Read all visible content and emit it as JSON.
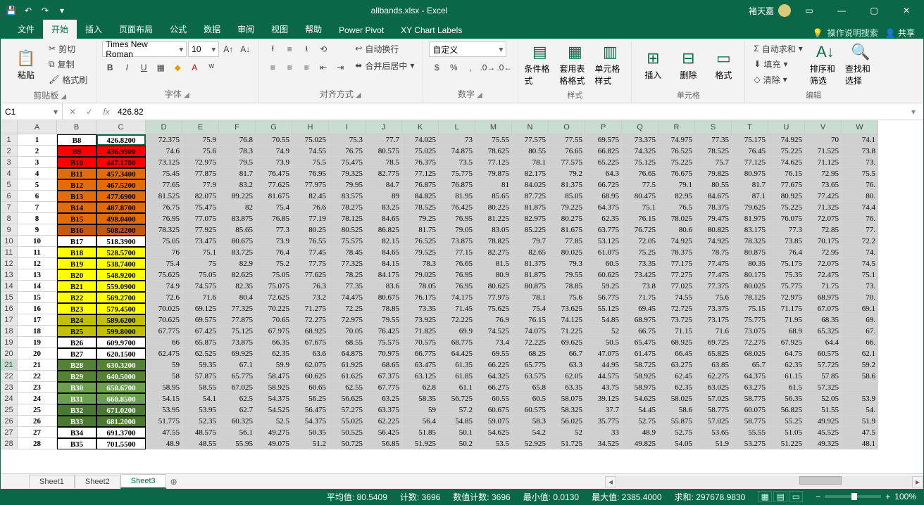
{
  "title": "allbands.xlsx - Excel",
  "user": "褚天嘉",
  "tabs": [
    "文件",
    "开始",
    "插入",
    "页面布局",
    "公式",
    "数据",
    "审阅",
    "视图",
    "帮助",
    "Power Pivot",
    "XY Chart Labels"
  ],
  "tell_me": "操作说明搜索",
  "share": "共享",
  "ribbon": {
    "clipboard": {
      "paste": "粘贴",
      "cut": "剪切",
      "copy": "复制",
      "painter": "格式刷",
      "label": "剪贴板"
    },
    "font": {
      "name": "Times New Roman",
      "size": "10",
      "label": "字体"
    },
    "align": {
      "wrap": "自动换行",
      "merge": "合并后居中",
      "label": "对齐方式"
    },
    "number": {
      "format": "自定义",
      "label": "数字"
    },
    "styles": {
      "cond": "条件格式",
      "table": "套用表格格式",
      "cell": "单元格样式",
      "label": "样式"
    },
    "cells": {
      "insert": "插入",
      "delete": "删除",
      "format": "格式",
      "label": "单元格"
    },
    "editing": {
      "sum": "自动求和",
      "fill": "填充",
      "clear": "清除",
      "sort": "排序和筛选",
      "find": "查找和选择",
      "label": "编辑"
    }
  },
  "namebox": "C1",
  "formula": "426.82",
  "cols": [
    "",
    "A",
    "B",
    "C",
    "D",
    "E",
    "F",
    "G",
    "H",
    "I",
    "J",
    "K",
    "L",
    "M",
    "N",
    "O",
    "P",
    "Q",
    "R",
    "S",
    "T",
    "U",
    "V",
    "W"
  ],
  "bfill": {
    "B8": "#ffffff",
    "B9": "#ff0000",
    "B10": "#ff0000",
    "B11": "#e26b0a",
    "B12": "#e26b0a",
    "B13": "#e26b0a",
    "B14": "#e26b0a",
    "B15": "#e26b0a",
    "B16": "#c65911",
    "B17": "#ffffff",
    "B18": "#ffff00",
    "B19": "#ffff00",
    "B20": "#ffff00",
    "B21": "#ffff00",
    "B22": "#ffff00",
    "B23": "#ffff00",
    "B24": "#c1c000",
    "B25": "#c1c000",
    "B26": "#ffffff",
    "B27": "#ffffff",
    "B28": "#548235",
    "B29": "#548235",
    "B30": "#6aa050",
    "B31": "#6aa050",
    "B32": "#4a7a32",
    "B33": "#4a7a32",
    "B34": "#ffffff",
    "B35": "#ffffff"
  },
  "btext": {
    "B8": "#000",
    "B9": "#000",
    "B10": "#000",
    "B11": "#000",
    "B12": "#000",
    "B13": "#000",
    "B14": "#000",
    "B15": "#000",
    "B16": "#000",
    "B17": "#000",
    "B18": "#000",
    "B19": "#000",
    "B20": "#000",
    "B21": "#000",
    "B22": "#000",
    "B23": "#000",
    "B24": "#000",
    "B25": "#000",
    "B26": "#000",
    "B27": "#000",
    "B28": "#fff",
    "B29": "#fff",
    "B30": "#fff",
    "B31": "#fff",
    "B32": "#fff",
    "B33": "#fff",
    "B34": "#000",
    "B35": "#000"
  },
  "rows": [
    {
      "n": 1,
      "a": "1",
      "b": "B8",
      "c": "426.8200",
      "d": [
        "72.375",
        "75.9",
        "76.8",
        "70.55",
        "75.025",
        "75.3",
        "77.7",
        "74.025",
        "73",
        "75.55",
        "77.575",
        "77.55",
        "69.575",
        "73.375",
        "74.975",
        "77.35",
        "75.175",
        "74.925",
        "70",
        "74.1"
      ]
    },
    {
      "n": 2,
      "a": "2",
      "b": "B9",
      "c": "436.9900",
      "d": [
        "74.6",
        "75.6",
        "78.3",
        "74.9",
        "74.55",
        "76.75",
        "80.575",
        "75.025",
        "74.875",
        "78.625",
        "80.55",
        "76.65",
        "66.825",
        "74.325",
        "76.525",
        "78.525",
        "76.45",
        "75.225",
        "71.525",
        "73.8"
      ]
    },
    {
      "n": 3,
      "a": "3",
      "b": "B10",
      "c": "447.1700",
      "d": [
        "73.125",
        "72.975",
        "79.5",
        "73.9",
        "75.5",
        "75.475",
        "78.5",
        "76.375",
        "73.5",
        "77.125",
        "78.1",
        "77.575",
        "65.225",
        "75.125",
        "75.225",
        "75.7",
        "77.125",
        "74.625",
        "71.125",
        "73."
      ]
    },
    {
      "n": 4,
      "a": "4",
      "b": "B11",
      "c": "457.3400",
      "d": [
        "75.45",
        "77.875",
        "81.7",
        "76.475",
        "76.95",
        "79.325",
        "82.775",
        "77.125",
        "75.775",
        "79.875",
        "82.175",
        "79.2",
        "64.3",
        "76.65",
        "76.675",
        "79.825",
        "80.975",
        "76.15",
        "72.95",
        "75.5"
      ]
    },
    {
      "n": 5,
      "a": "5",
      "b": "B12",
      "c": "467.5200",
      "d": [
        "77.65",
        "77.9",
        "83.2",
        "77.625",
        "77.975",
        "79.95",
        "84.7",
        "76.875",
        "76.875",
        "81",
        "84.025",
        "81.375",
        "66.725",
        "77.5",
        "79.1",
        "80.55",
        "81.7",
        "77.675",
        "73.65",
        "76."
      ]
    },
    {
      "n": 6,
      "a": "6",
      "b": "B13",
      "c": "477.6900",
      "d": [
        "81.525",
        "82.075",
        "89.225",
        "81.675",
        "82.45",
        "83.575",
        "89",
        "84.825",
        "81.95",
        "85.65",
        "87.725",
        "85.05",
        "68.95",
        "80.475",
        "82.95",
        "84.675",
        "87.1",
        "80.925",
        "77.425",
        "80."
      ]
    },
    {
      "n": 7,
      "a": "7",
      "b": "B14",
      "c": "487.8700",
      "d": [
        "76.75",
        "75.475",
        "82",
        "75.4",
        "76.6",
        "78.275",
        "83.25",
        "78.525",
        "76.425",
        "80.225",
        "81.875",
        "79.225",
        "64.375",
        "75.1",
        "76.5",
        "78.375",
        "79.625",
        "75.225",
        "71.325",
        "74.4"
      ]
    },
    {
      "n": 8,
      "a": "8",
      "b": "B15",
      "c": "498.0400",
      "d": [
        "76.95",
        "77.075",
        "83.875",
        "76.85",
        "77.19",
        "78.125",
        "84.65",
        "79.25",
        "76.95",
        "81.225",
        "82.975",
        "80.275",
        "62.35",
        "76.15",
        "78.025",
        "79.475",
        "81.975",
        "76.075",
        "72.075",
        "76."
      ]
    },
    {
      "n": 9,
      "a": "9",
      "b": "B16",
      "c": "508.2200",
      "d": [
        "78.325",
        "77.925",
        "85.65",
        "77.3",
        "80.25",
        "80.525",
        "86.825",
        "81.75",
        "79.05",
        "83.05",
        "85.225",
        "81.675",
        "63.775",
        "76.725",
        "80.6",
        "80.825",
        "83.175",
        "77.3",
        "72.85",
        "77."
      ]
    },
    {
      "n": 10,
      "a": "10",
      "b": "B17",
      "c": "518.3900",
      "d": [
        "75.05",
        "73.475",
        "80.675",
        "73.9",
        "76.55",
        "75.575",
        "82.15",
        "76.525",
        "73.875",
        "78.825",
        "79.7",
        "77.85",
        "53.125",
        "72.05",
        "74.925",
        "74.925",
        "78.325",
        "73.85",
        "70.175",
        "72.2"
      ]
    },
    {
      "n": 11,
      "a": "11",
      "b": "B18",
      "c": "528.5700",
      "d": [
        "76",
        "75.1",
        "83.725",
        "76.4",
        "77.45",
        "78.45",
        "84.65",
        "79.525",
        "77.15",
        "82.275",
        "82.65",
        "80.025",
        "61.075",
        "75.25",
        "78.375",
        "78.75",
        "80.875",
        "76.4",
        "72.95",
        "74."
      ]
    },
    {
      "n": 12,
      "a": "12",
      "b": "B19",
      "c": "538.7400",
      "d": [
        "75.4",
        "75",
        "82.9",
        "75.2",
        "77.75",
        "77.325",
        "84.15",
        "78.3",
        "76.65",
        "81.5",
        "81.375",
        "79.3",
        "60.5",
        "73.35",
        "77.175",
        "77.475",
        "80.35",
        "75.175",
        "72.075",
        "74.5"
      ]
    },
    {
      "n": 13,
      "a": "13",
      "b": "B20",
      "c": "548.9200",
      "d": [
        "75.625",
        "75.05",
        "82.625",
        "75.05",
        "77.625",
        "78.25",
        "84.175",
        "79.025",
        "76.95",
        "80.9",
        "81.875",
        "79.55",
        "60.625",
        "73.425",
        "77.275",
        "77.475",
        "80.175",
        "75.35",
        "72.475",
        "75.1"
      ]
    },
    {
      "n": 14,
      "a": "14",
      "b": "B21",
      "c": "559.0900",
      "d": [
        "74.9",
        "74.575",
        "82.35",
        "75.075",
        "76.3",
        "77.35",
        "83.6",
        "78.05",
        "76.95",
        "80.625",
        "80.875",
        "78.85",
        "59.25",
        "73.8",
        "77.025",
        "77.375",
        "80.025",
        "75.775",
        "71.75",
        "73."
      ]
    },
    {
      "n": 15,
      "a": "15",
      "b": "B22",
      "c": "569.2700",
      "d": [
        "72.6",
        "71.6",
        "80.4",
        "72.625",
        "73.2",
        "74.475",
        "80.675",
        "76.175",
        "74.175",
        "77.975",
        "78.1",
        "75.6",
        "56.775",
        "71.75",
        "74.55",
        "75.6",
        "78.125",
        "72.975",
        "68.975",
        "70."
      ]
    },
    {
      "n": 16,
      "a": "16",
      "b": "B23",
      "c": "579.4500",
      "d": [
        "70.025",
        "69.125",
        "77.325",
        "70.225",
        "71.275",
        "72.25",
        "78.85",
        "73.35",
        "71.45",
        "75.625",
        "75.4",
        "73.625",
        "55.125",
        "69.45",
        "72.725",
        "73.375",
        "75.15",
        "71.175",
        "67.075",
        "69.1"
      ]
    },
    {
      "n": 17,
      "a": "17",
      "b": "B24",
      "c": "589.6200",
      "d": [
        "70.625",
        "69.575",
        "77.875",
        "70.65",
        "72.275",
        "72.975",
        "79.55",
        "73.925",
        "72.225",
        "76.9",
        "76.15",
        "74.125",
        "54.85",
        "68.975",
        "73.725",
        "73.175",
        "75.775",
        "71.95",
        "68.35",
        "69."
      ]
    },
    {
      "n": 18,
      "a": "18",
      "b": "B25",
      "c": "599.8000",
      "d": [
        "67.775",
        "67.425",
        "75.125",
        "67.975",
        "68.925",
        "70.05",
        "76.425",
        "71.825",
        "69.9",
        "74.525",
        "74.075",
        "71.225",
        "52",
        "66.75",
        "71.15",
        "71.6",
        "73.075",
        "68.9",
        "65.325",
        "67."
      ]
    },
    {
      "n": 19,
      "a": "19",
      "b": "B26",
      "c": "609.9700",
      "d": [
        "66",
        "65.875",
        "73.875",
        "66.35",
        "67.675",
        "68.55",
        "75.575",
        "70.575",
        "68.775",
        "73.4",
        "72.225",
        "69.625",
        "50.5",
        "65.475",
        "68.925",
        "69.725",
        "72.275",
        "67.925",
        "64.4",
        "66."
      ]
    },
    {
      "n": 20,
      "a": "20",
      "b": "B27",
      "c": "620.1500",
      "d": [
        "62.475",
        "62.525",
        "69.925",
        "62.35",
        "63.6",
        "64.875",
        "70.975",
        "66.775",
        "64.425",
        "69.55",
        "68.25",
        "66.7",
        "47.075",
        "61.475",
        "66.45",
        "65.825",
        "68.025",
        "64.75",
        "60.575",
        "62.1"
      ]
    },
    {
      "n": 21,
      "a": "21",
      "b": "B28",
      "c": "630.3200",
      "d": [
        "59",
        "59.35",
        "67.1",
        "59.9",
        "62.075",
        "61.925",
        "68.65",
        "63.475",
        "61.35",
        "66.225",
        "65.775",
        "63.3",
        "44.95",
        "58.725",
        "63.275",
        "63.85",
        "65.7",
        "62.35",
        "57.725",
        "59.2"
      ]
    },
    {
      "n": 22,
      "a": "22",
      "b": "B29",
      "c": "640.5000",
      "d": [
        "58",
        "57.875",
        "65.775",
        "58.475",
        "60.625",
        "61.625",
        "67.375",
        "63.125",
        "61.85",
        "64.325",
        "63.575",
        "62.05",
        "44.575",
        "58.925",
        "62.45",
        "62.275",
        "64.375",
        "61.15",
        "57.85",
        "58.6"
      ]
    },
    {
      "n": 23,
      "a": "23",
      "b": "B30",
      "c": "650.6700",
      "d": [
        "58.95",
        "58.55",
        "67.025",
        "58.925",
        "60.65",
        "62.55",
        "67.775",
        "62.8",
        "61.1",
        "66.275",
        "65.8",
        "63.35",
        "43.75",
        "58.975",
        "62.35",
        "63.025",
        "63.275",
        "61.5",
        "57.325",
        ""
      ]
    },
    {
      "n": 24,
      "a": "24",
      "b": "B31",
      "c": "660.8500",
      "d": [
        "54.15",
        "54.1",
        "62.5",
        "54.375",
        "56.25",
        "56.625",
        "63.25",
        "58.35",
        "56.725",
        "60.55",
        "60.5",
        "58.075",
        "39.125",
        "54.625",
        "58.025",
        "57.025",
        "58.775",
        "56.35",
        "52.05",
        "53.9"
      ]
    },
    {
      "n": 25,
      "a": "25",
      "b": "B32",
      "c": "671.0200",
      "d": [
        "53.95",
        "53.95",
        "62.7",
        "54.525",
        "56.475",
        "57.275",
        "63.375",
        "59",
        "57.2",
        "60.675",
        "60.575",
        "58.325",
        "37.7",
        "54.45",
        "58.6",
        "58.775",
        "60.075",
        "56.825",
        "51.55",
        "54."
      ]
    },
    {
      "n": 26,
      "a": "26",
      "b": "B33",
      "c": "681.2000",
      "d": [
        "51.775",
        "52.35",
        "60.325",
        "52.5",
        "54.375",
        "55.025",
        "62.225",
        "56.4",
        "54.85",
        "59.075",
        "58.3",
        "56.025",
        "35.775",
        "52.75",
        "55.875",
        "57.025",
        "58.775",
        "55.25",
        "49.925",
        "51.9"
      ]
    },
    {
      "n": 27,
      "a": "27",
      "b": "B34",
      "c": "691.3700",
      "d": [
        "47.55",
        "48.575",
        "56.1",
        "49.275",
        "50.35",
        "50.525",
        "56.425",
        "51.85",
        "50.1",
        "54.625",
        "54.2",
        "52",
        "33",
        "48.9",
        "52.75",
        "53.65",
        "55.55",
        "51.05",
        "45.525",
        "47.5"
      ]
    },
    {
      "n": 28,
      "a": "28",
      "b": "B35",
      "c": "701.5500",
      "d": [
        "48.9",
        "48.55",
        "55.95",
        "49.075",
        "51.2",
        "50.725",
        "56.85",
        "51.925",
        "50.2",
        "53.5",
        "52.925",
        "51.725",
        "34.525",
        "49.825",
        "54.05",
        "51.9",
        "53.275",
        "51.225",
        "49.325",
        "48.1"
      ]
    }
  ],
  "sheets": [
    "Sheet1",
    "Sheet2",
    "Sheet3"
  ],
  "active_sheet": 2,
  "status": {
    "avg_l": "平均值:",
    "avg": "80.5409",
    "cnt_l": "计数:",
    "cnt": "3696",
    "ncnt_l": "数值计数:",
    "ncnt": "3696",
    "min_l": "最小值:",
    "min": "0.0130",
    "max_l": "最大值:",
    "max": "2385.4000",
    "sum_l": "求和:",
    "sum": "297678.9830",
    "zoom": "100%"
  }
}
